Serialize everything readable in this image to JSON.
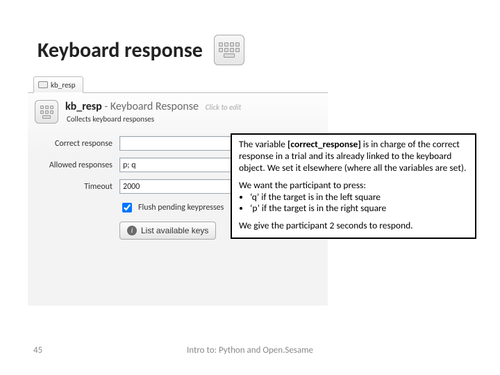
{
  "title": "Keyboard response",
  "ui": {
    "tab_label": "kb_resp",
    "item_name": "kb_resp",
    "item_type": "Keyboard Response",
    "edit_hint": "Click to edit",
    "description": "Collects keyboard responses",
    "labels": {
      "correct": "Correct response",
      "allowed": "Allowed responses",
      "timeout": "Timeout",
      "flush": "Flush pending keypresses",
      "list_btn": "List available keys"
    },
    "values": {
      "correct": "",
      "allowed": "p; q",
      "timeout": "2000",
      "flush_checked": true
    }
  },
  "commentary": {
    "p1_a": "The variable ",
    "p1_b": "[correct_response]",
    "p1_c": " is in charge of the correct response in a trial and its already linked to the keyboard object. We set it elsewhere (where all the variables are set).",
    "p2": "We want the participant to press:",
    "li1": "‘q’ if the target is in the left square",
    "li2": "‘p’ if the target is in the right square",
    "p3": "We give the participant 2 seconds to respond."
  },
  "footer": {
    "page": "45",
    "text": "Intro to: Python and Open.Sesame"
  }
}
